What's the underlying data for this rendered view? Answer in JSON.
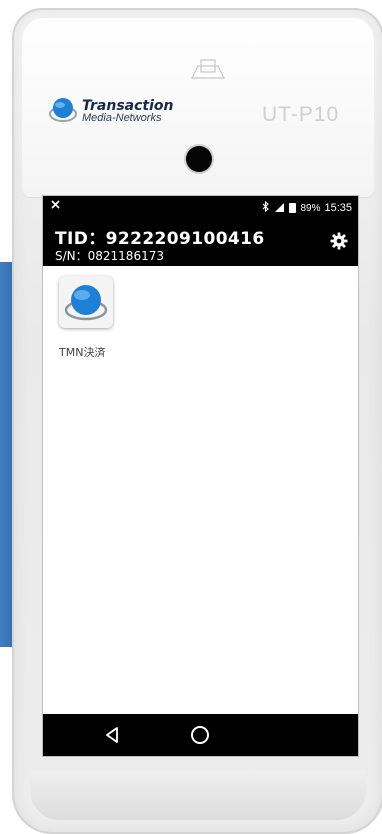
{
  "device": {
    "brand_line1": "Transaction",
    "brand_line2": "Media-Networks",
    "model": "UT-P10"
  },
  "status_bar": {
    "left_icon": "no-sim-icon",
    "bluetooth_icon": "bluetooth-icon",
    "signal_icon": "4g-signal-icon",
    "battery_icon": "battery-icon",
    "battery": "89%",
    "time": "15:35"
  },
  "header": {
    "tid": "TID：9222209100416",
    "serial": "S/N：0821186173",
    "settings_icon": "gear-icon"
  },
  "apps": [
    {
      "label": "TMN決済",
      "icon": "tmn-globe-icon"
    }
  ],
  "nav_bar": {
    "back_icon": "back-triangle-icon",
    "home_icon": "home-circle-icon"
  },
  "colors": {
    "bar_background": "#000000",
    "screen_background": "#ffffff",
    "brand_blue": "#1e7fd6",
    "side_card_blue": "#3a78bb"
  }
}
